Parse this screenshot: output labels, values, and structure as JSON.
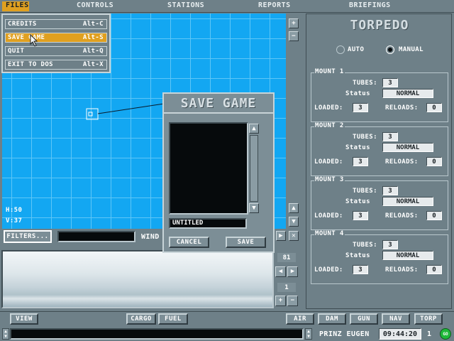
{
  "menubar": {
    "files": "FILES",
    "controls": "CONTROLS",
    "stations": "STATIONS",
    "reports": "REPORTS",
    "briefings": "BRIEFINGS"
  },
  "files_menu": {
    "items": [
      {
        "label": "CREDITS",
        "shortcut": "Alt-C"
      },
      {
        "label": "SAVE GAME",
        "shortcut": "Alt-S"
      },
      {
        "label": "QUIT",
        "shortcut": "Alt-Q"
      },
      {
        "label": "EXIT TO DOS",
        "shortcut": "Alt-X"
      }
    ]
  },
  "map": {
    "h_readout": "H:50",
    "v_readout": "V:37",
    "filters_button": "FILTERS...",
    "wind_label": "WIND"
  },
  "save_dialog": {
    "title": "SAVE GAME",
    "filename_value": "UNTITLED",
    "cancel_button": "CANCEL",
    "save_button": "SAVE"
  },
  "zoom": {
    "value_top": "81",
    "value_bottom": "1"
  },
  "torpedo": {
    "title": "TORPEDO",
    "mode_auto": "AUTO",
    "mode_manual": "MANUAL",
    "selected_mode": "MANUAL",
    "mounts": [
      {
        "name": "MOUNT 1",
        "tubes_label": "TUBES:",
        "tubes": "3",
        "status_label": "Status",
        "status": "NORMAL",
        "loaded_label": "LOADED:",
        "loaded": "3",
        "reloads_label": "RELOADS:",
        "reloads": "0"
      },
      {
        "name": "MOUNT 2",
        "tubes_label": "TUBES:",
        "tubes": "3",
        "status_label": "Status",
        "status": "NORMAL",
        "loaded_label": "LOADED:",
        "loaded": "3",
        "reloads_label": "RELOADS:",
        "reloads": "0"
      },
      {
        "name": "MOUNT 3",
        "tubes_label": "TUBES:",
        "tubes": "3",
        "status_label": "Status",
        "status": "NORMAL",
        "loaded_label": "LOADED:",
        "loaded": "3",
        "reloads_label": "RELOADS:",
        "reloads": "0"
      },
      {
        "name": "MOUNT 4",
        "tubes_label": "TUBES:",
        "tubes": "3",
        "status_label": "Status",
        "status": "NORMAL",
        "loaded_label": "LOADED:",
        "loaded": "3",
        "reloads_label": "RELOADS:",
        "reloads": "0"
      }
    ]
  },
  "bottom_bar": {
    "view": "VIEW",
    "cargo": "CARGO",
    "fuel": "FUEL",
    "air": "AIR",
    "dam": "DAM",
    "gun": "GUN",
    "nav": "NAV",
    "torp": "TORP"
  },
  "status_bar": {
    "ship_name": "PRINZ EUGEN",
    "clock": "09:44:20",
    "speed": "1",
    "go": "GO"
  },
  "colors": {
    "panel": "#6e8088",
    "map_water": "#13a7f2",
    "menu_highlight": "#e0a020"
  }
}
